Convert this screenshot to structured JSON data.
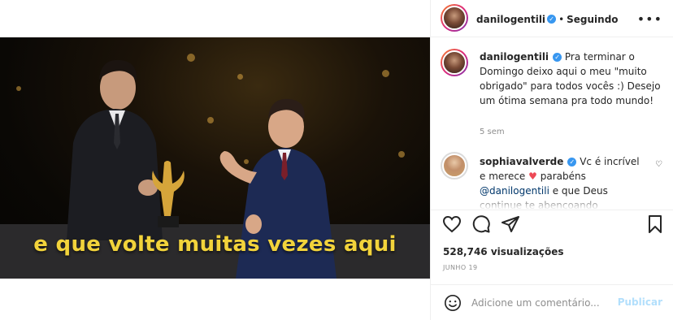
{
  "header": {
    "username": "danilogentili",
    "separator": "•",
    "following_label": "Seguindo",
    "more_symbol": "•••"
  },
  "video": {
    "caption": "e que volte muitas vezes aqui"
  },
  "comments": [
    {
      "username": "danilogentili",
      "text": "Pra terminar o Domingo deixo aqui o meu \"muito obrigado\" para todos vocês :) Desejo um ótima semana pra todo mundo!",
      "time": "5 sem"
    },
    {
      "username": "sophiavalverde",
      "text_before": "Vc é incrível e merece",
      "text_after": "parabéns",
      "mention": "@danilogentili",
      "text_end": "e que Deus continue te abençoando"
    }
  ],
  "stats": {
    "views": "528,746 visualizações",
    "date": "JUNHO 19"
  },
  "add_comment": {
    "placeholder": "Adicione um comentário...",
    "publish_label": "Publicar"
  },
  "icons": {
    "like": "heart-icon",
    "comment": "comment-icon",
    "share": "send-icon",
    "save": "bookmark-icon",
    "emoji": "emoji-icon",
    "more": "more-icon"
  },
  "colors": {
    "caption": "#f2d33b",
    "verified": "#3897f0",
    "publish": "#b2dffc",
    "heart": "#ed4956"
  }
}
